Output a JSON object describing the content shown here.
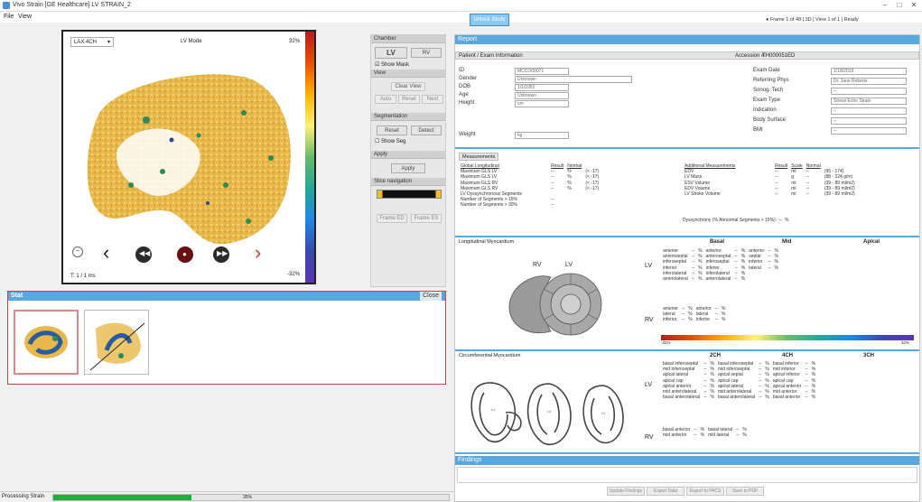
{
  "window": {
    "title": "Vivo Strain  [GE Healthcare]  LV STRAIN_2",
    "minimize": "–",
    "maximize": "□",
    "close": "✕"
  },
  "menu": {
    "file": "File",
    "view": "View"
  },
  "toolbar": {
    "highlight_button": "Unlock Study",
    "status_text": "● Frame 1 of 48  |  3D  |  View 1 of 1  |  Ready"
  },
  "viewer": {
    "view_select": "LAX 4CH",
    "mode_label": "LV Mode",
    "scale_top": "32%",
    "scale_bottom": "-32%",
    "frame_info": "T: 1 / 1  ms"
  },
  "controls": {
    "chamber_header": "Chamber",
    "lv_label": "LV",
    "rv_label": "RV",
    "show_mask_label": "Show Mask",
    "view_header": "View",
    "view_clear": "Clear View",
    "view_btns": [
      "Auto",
      "Reset",
      "Next"
    ],
    "segment_header": "Segmentation",
    "seg_btns": [
      "Reset",
      "Detect"
    ],
    "show_seg_label": "Show Seg",
    "apply_header": "Apply",
    "apply_btn": "Apply",
    "slice_header": "Slice navigation",
    "compare_btns": [
      "Frame ED",
      "Frame ES"
    ]
  },
  "views_panel": {
    "title": "Stat",
    "close_label": "Close"
  },
  "status_bar": {
    "label": "Processing Strain",
    "progress_text": "35%",
    "progress": 0.35
  },
  "report": {
    "title": "Report",
    "patient_header": "Patient / Exam Information",
    "accession_label": "Accession #:",
    "accession_value": "TH000051ED",
    "left_fields": [
      {
        "label": "ID",
        "value": "MCCO00071"
      },
      {
        "label": "Gender",
        "value": "Unknown"
      },
      {
        "label": "DOB",
        "value": "1/1/1951"
      },
      {
        "label": "Age",
        "value": "Unknown"
      },
      {
        "label": "Height",
        "value": "cm"
      },
      {
        "label": "Weight",
        "value": "kg"
      }
    ],
    "right_fields": [
      {
        "label": "Exam Date",
        "value": "1/18/2019"
      },
      {
        "label": "Referring Phys",
        "value": "Dr. Jane Roberts"
      },
      {
        "label": "Sonog. Tech",
        "value": "--"
      },
      {
        "label": "Exam Type",
        "value": "Stress Echo Strain"
      },
      {
        "label": "Indication",
        "value": "--"
      },
      {
        "label": "Body Surface",
        "value": "--"
      },
      {
        "label": "BMI",
        "value": "--"
      }
    ],
    "measurements_tab": "Measurements",
    "strain_table_left": {
      "headers": [
        "Global Longitudinal",
        "Result",
        "Normal"
      ],
      "rows": [
        [
          "Maximum GLS LV",
          "--",
          "%",
          "(< -17)"
        ],
        [
          "Maximum GLS LV",
          "--",
          "%",
          "(< -17)"
        ],
        [
          "Maximum GLS RV",
          "--",
          "%",
          "(< -17)"
        ],
        [
          "Maximum GLS RV",
          "--",
          "%",
          "(< -17)"
        ],
        [
          "LV Dyssynchronous Segments",
          "",
          "",
          ""
        ],
        [
          "Number of Segments > 15%",
          "--",
          "",
          ""
        ],
        [
          "Number of Segments > 30%",
          "--",
          "",
          ""
        ]
      ]
    },
    "strain_table_right": {
      "headers": [
        "Additional Measurements",
        "Result",
        "Scale",
        "Normal"
      ],
      "rows": [
        [
          "EDV",
          "--",
          "ml",
          "--",
          "(95 - 174)"
        ],
        [
          "LV Mass",
          "--",
          "g",
          "--",
          "(88 - 224 g/m)"
        ],
        [
          "ESV Volume",
          "--",
          "ml",
          "--",
          "(39 - 89 ml/m2)"
        ],
        [
          "EDV Volume",
          "--",
          "ml",
          "--",
          "(39 - 89 ml/m2)"
        ],
        [
          "LV Stroke Volume",
          "--",
          "ml",
          "--",
          "(39 - 89 ml/m2)"
        ]
      ],
      "dyssync_label": "Dyssynchrony (% Abnormal Segments > 15%):",
      "dyssync_value": "--",
      "dyssync_unit": "%"
    },
    "longitudinal_title": "Longitudinal Myocardium",
    "long_cols": [
      "Basal",
      "Mid",
      "Apical"
    ],
    "long_rv_lv": {
      "rv": "RV",
      "lv": "LV"
    },
    "long_lv_rows": [
      [
        "anterior",
        "--",
        "%",
        "anterior",
        "--",
        "%",
        "anterior",
        "--",
        "%"
      ],
      [
        "anteroseptal",
        "--",
        "%",
        "anteroseptal",
        "--",
        "%",
        "septal",
        "--",
        "%"
      ],
      [
        "inferoseptal",
        "--",
        "%",
        "inferoseptal",
        "--",
        "%",
        "inferior",
        "--",
        "%"
      ],
      [
        "inferior",
        "--",
        "%",
        "inferior",
        "--",
        "%",
        "lateral",
        "--",
        "%"
      ],
      [
        "inferolateral",
        "--",
        "%",
        "inferolateral",
        "--",
        "%",
        "",
        "",
        ""
      ],
      [
        "anterolateral",
        "--",
        "%",
        "anterolateral",
        "--",
        "%",
        "",
        "",
        ""
      ]
    ],
    "long_rv_rows": [
      [
        "anterior",
        "--",
        "%",
        "anterior",
        "--",
        "%"
      ],
      [
        "lateral",
        "--",
        "%",
        "lateral",
        "--",
        "%"
      ],
      [
        "inferior",
        "--",
        "%",
        "inferior",
        "--",
        "%"
      ]
    ],
    "color_scale_left": "-32%",
    "color_scale_right": "32%",
    "circ_title": "Circumferential Myocardium",
    "circ_cols": [
      "2CH",
      "4CH",
      "3CH"
    ],
    "circ_lv_rows": [
      [
        "basal inferoseptal",
        "--",
        "%",
        "basal inferoseptal",
        "--",
        "%",
        "basal inferior",
        "--",
        "%"
      ],
      [
        "mid inferoseptal",
        "--",
        "%",
        "mid inferoseptal",
        "--",
        "%",
        "mid inferior",
        "--",
        "%"
      ],
      [
        "apical lateral",
        "--",
        "%",
        "apical septal",
        "--",
        "%",
        "apical inferior",
        "--",
        "%"
      ],
      [
        "apical cap",
        "--",
        "%",
        "apical cap",
        "--",
        "%",
        "apical cap",
        "--",
        "%"
      ],
      [
        "apical anterior",
        "--",
        "%",
        "apical lateral",
        "--",
        "%",
        "apical anterior",
        "--",
        "%"
      ],
      [
        "mid anterolateral",
        "--",
        "%",
        "mid anterolateral",
        "--",
        "%",
        "mid anterior",
        "--",
        "%"
      ],
      [
        "basal anterolateral",
        "--",
        "%",
        "basal anterolateral",
        "--",
        "%",
        "basal anterior",
        "--",
        "%"
      ]
    ],
    "circ_rv_rows": [
      [
        "basal anterior",
        "--",
        "%",
        "basal lateral",
        "--",
        "%"
      ],
      [
        "mid anterior",
        "--",
        "%",
        "mid lateral",
        "--",
        "%"
      ]
    ],
    "findings_header": "Findings",
    "footer_buttons": [
      "Update Findings",
      "Export Data",
      "Export to PACS",
      "Save to PDF"
    ]
  }
}
